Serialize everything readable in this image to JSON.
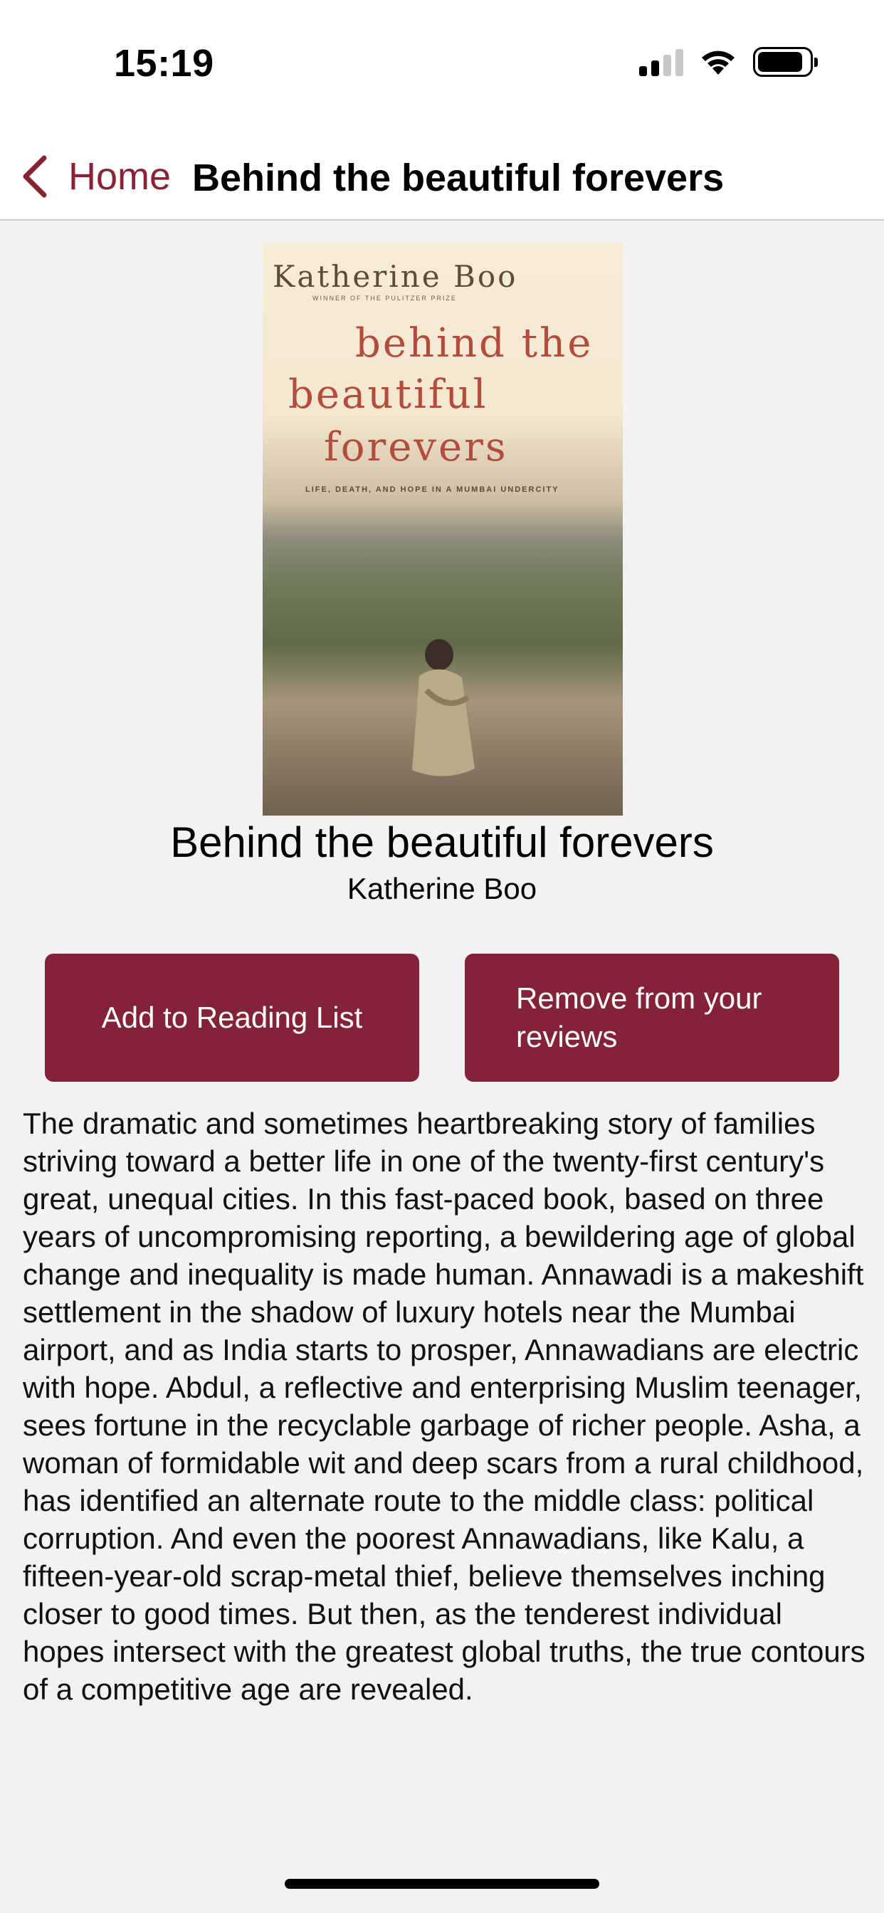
{
  "status_bar": {
    "time": "15:19",
    "icons": [
      "cellular-signal-icon",
      "wifi-icon",
      "battery-icon"
    ]
  },
  "nav": {
    "back_label": "Home",
    "title": "Behind the beautiful forevers"
  },
  "cover": {
    "author": "Katherine Boo",
    "tagline": "WINNER OF THE PULITZER PRIZE",
    "title_lines": [
      "behind the",
      "beautiful",
      "forevers"
    ],
    "subtitle": "LIFE, DEATH, AND HOPE IN A MUMBAI UNDERCITY"
  },
  "book": {
    "title": "Behind the beautiful forevers",
    "author": "Katherine Boo"
  },
  "actions": {
    "add_label": "Add to Reading List",
    "remove_label": "Remove from your reviews"
  },
  "description": "The dramatic and sometimes heartbreaking story of families striving toward a better life in one of the twenty-first century's great, unequal cities. In this fast-paced book, based on three years of uncompromising reporting, a bewildering age of global change and inequality is made human. Annawadi is a makeshift settlement in the shadow of luxury hotels near the Mumbai airport, and as India starts to prosper, Annawadians are electric with hope. Abdul, a reflective and enterprising Muslim teenager, sees fortune in the recyclable garbage of richer people. Asha, a woman of formidable wit and deep scars from a rural childhood, has identified an alternate route to the middle class: political corruption. And even the poorest Annawadians, like Kalu, a fifteen-year-old scrap-metal thief, believe themselves inching closer to good times. But then, as the tenderest individual hopes intersect with the greatest global truths, the true contours of a competitive age are revealed.",
  "colors": {
    "accent": "#842237",
    "nav_tint": "#8a2236",
    "background": "#f2f2f2"
  }
}
